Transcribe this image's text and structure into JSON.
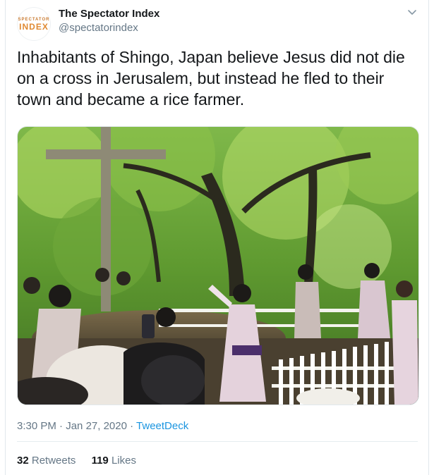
{
  "author": {
    "name": "The Spectator Index",
    "handle": "@spectatorindex",
    "avatar_top": "SPECTATOR",
    "avatar_bottom": "INDEX"
  },
  "tweet": {
    "text": "Inhabitants of Shingo, Japan believe Jesus did not die on a cross in Jerusalem, but instead he fled to their town and became a rice farmer."
  },
  "meta": {
    "time": "3:30 PM",
    "sep1": " · ",
    "date": "Jan 27, 2020",
    "sep2": " · ",
    "source": "TweetDeck"
  },
  "stats": {
    "retweets_count": "32",
    "retweets_label": "Retweets",
    "likes_count": "119",
    "likes_label": "Likes"
  },
  "icons": {
    "menu": "chevron-down-icon"
  },
  "colors": {
    "link": "#1b95e0",
    "secondary_text": "#657786",
    "avatar_orange": "#e08a33"
  }
}
